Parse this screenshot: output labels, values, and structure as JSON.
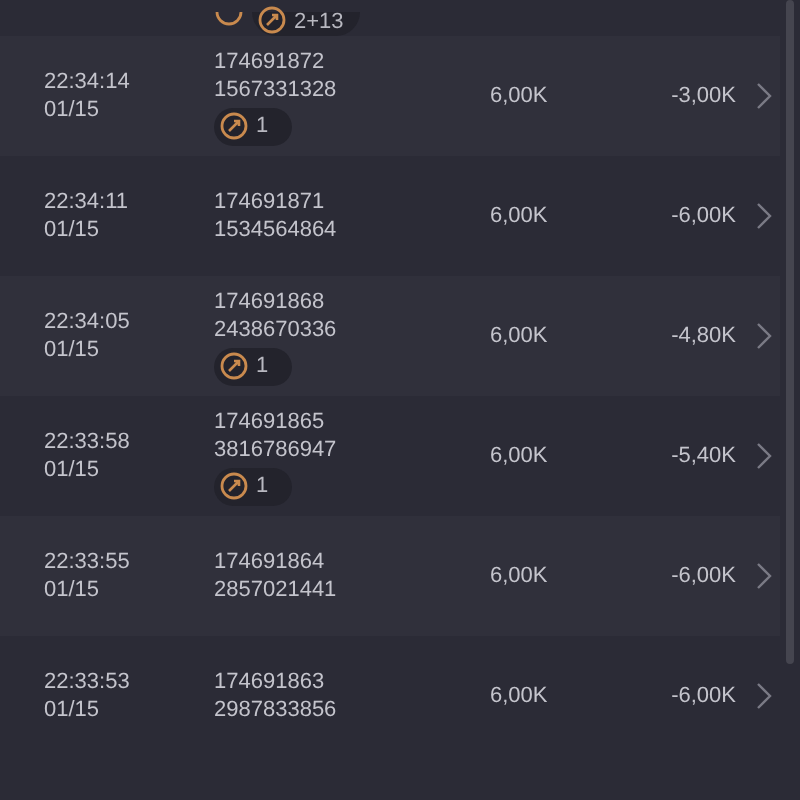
{
  "top_row": {
    "badges": [
      {
        "kind": "spinner"
      },
      {
        "kind": "count",
        "text": "2+13"
      }
    ]
  },
  "rows": [
    {
      "time": "22:34:14",
      "date": "01/15",
      "id": "174691872",
      "ref": "1567331328",
      "badge": "1",
      "amount": "6,00K",
      "result": "-3,00K"
    },
    {
      "time": "22:34:11",
      "date": "01/15",
      "id": "174691871",
      "ref": "1534564864",
      "amount": "6,00K",
      "result": "-6,00K"
    },
    {
      "time": "22:34:05",
      "date": "01/15",
      "id": "174691868",
      "ref": "2438670336",
      "badge": "1",
      "amount": "6,00K",
      "result": "-4,80K"
    },
    {
      "time": "22:33:58",
      "date": "01/15",
      "id": "174691865",
      "ref": "3816786947",
      "badge": "1",
      "amount": "6,00K",
      "result": "-5,40K"
    },
    {
      "time": "22:33:55",
      "date": "01/15",
      "id": "174691864",
      "ref": "2857021441",
      "amount": "6,00K",
      "result": "-6,00K"
    },
    {
      "time": "22:33:53",
      "date": "01/15",
      "id": "174691863",
      "ref": "2987833856",
      "amount": "6,00K",
      "result": "-6,00K"
    }
  ]
}
